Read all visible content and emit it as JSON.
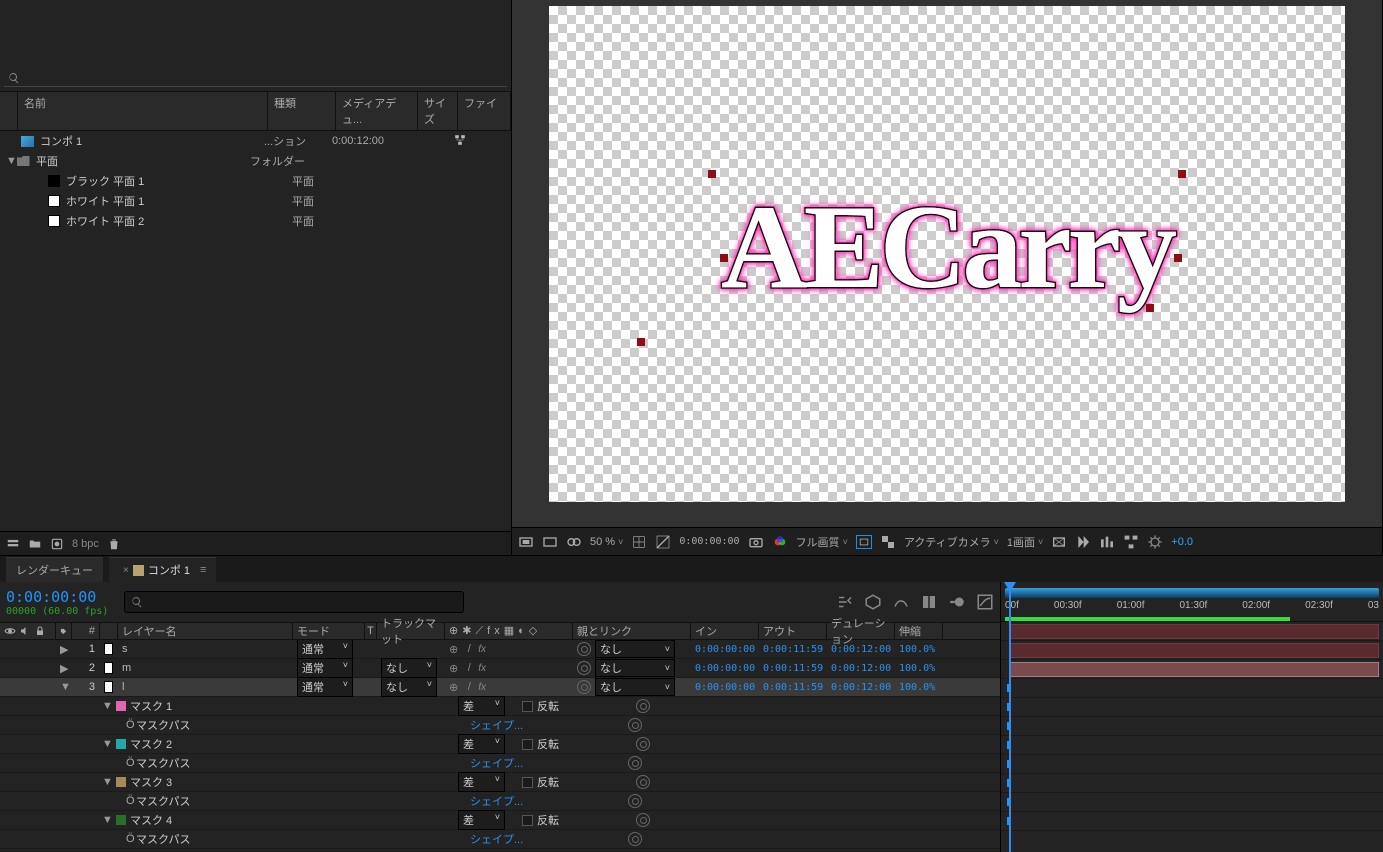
{
  "project": {
    "search_placeholder": "",
    "columns": {
      "name": "名前",
      "kind": "種類",
      "media_dur": "メディアデュ...",
      "size": "サイズ",
      "file": "ファイ"
    },
    "rows": [
      {
        "name": "コンポ 1",
        "kind": "...ション",
        "media_dur": "0:00:12:00",
        "icon": "comp",
        "has_flow": true
      },
      {
        "name": "平面",
        "kind": "フォルダー",
        "icon": "folder",
        "twirl": true
      },
      {
        "name": "ブラック 平面 1",
        "kind": "平面",
        "swatch": "black",
        "indent": 2
      },
      {
        "name": "ホワイト 平面 1",
        "kind": "平面",
        "swatch": "white",
        "indent": 2
      },
      {
        "name": "ホワイト 平面 2",
        "kind": "平面",
        "swatch": "white",
        "indent": 2
      }
    ],
    "footer_bpc": "8 bpc"
  },
  "viewer": {
    "text": "AECarry",
    "toolbar": {
      "zoom": "50 %",
      "timecode": "0:00:00:00",
      "quality": "フル画質",
      "camera": "アクティブカメラ",
      "views": "1画面",
      "exposure": "+0.0"
    }
  },
  "timeline": {
    "tabs": {
      "render_queue": "レンダーキュー",
      "comp": "コンポ 1"
    },
    "current_time": "0:00:00:00",
    "fps_line": "00000 (60.00 fps)",
    "columns": {
      "hash": "#",
      "layer_name": "レイヤー名",
      "mode": "モード",
      "t": "T",
      "track_matte": "トラックマット",
      "parent": "親とリンク",
      "in": "イン",
      "out": "アウト",
      "duration": "デュレーション",
      "stretch": "伸縮"
    },
    "layers": [
      {
        "idx": 1,
        "name": "s",
        "mode": "通常",
        "matte": "",
        "parent": "なし",
        "in": "0:00:00:00",
        "out": "0:00:11:59",
        "dur": "0:00:12:00",
        "stretch": "100.0%",
        "swatch": "white"
      },
      {
        "idx": 2,
        "name": "m",
        "mode": "通常",
        "matte": "なし",
        "parent": "なし",
        "in": "0:00:00:00",
        "out": "0:00:11:59",
        "dur": "0:00:12:00",
        "stretch": "100.0%",
        "swatch": "white"
      },
      {
        "idx": 3,
        "name": "l",
        "mode": "通常",
        "matte": "なし",
        "parent": "なし",
        "in": "0:00:00:00",
        "out": "0:00:11:59",
        "dur": "0:00:12:00",
        "stretch": "100.0%",
        "swatch": "white",
        "selected": true
      }
    ],
    "masks": [
      {
        "name": "マスク 1",
        "color": "mask-pink",
        "mode": "差",
        "invert": "反転",
        "shape": "シェイプ...",
        "path_label": "マスクパス"
      },
      {
        "name": "マスク 2",
        "color": "mask-teal",
        "mode": "差",
        "invert": "反転",
        "shape": "シェイプ...",
        "path_label": "マスクパス"
      },
      {
        "name": "マスク 3",
        "color": "mask-brown",
        "mode": "差",
        "invert": "反転",
        "shape": "シェイプ...",
        "path_label": "マスクパス"
      },
      {
        "name": "マスク 4",
        "color": "mask-green",
        "mode": "差",
        "invert": "反転",
        "shape": "シェイプ...",
        "path_label": "マスクパス"
      }
    ],
    "mask_path_icon": "Ö",
    "ruler": [
      "00f",
      "00:30f",
      "01:00f",
      "01:30f",
      "02:00f",
      "02:30f",
      "03"
    ]
  }
}
